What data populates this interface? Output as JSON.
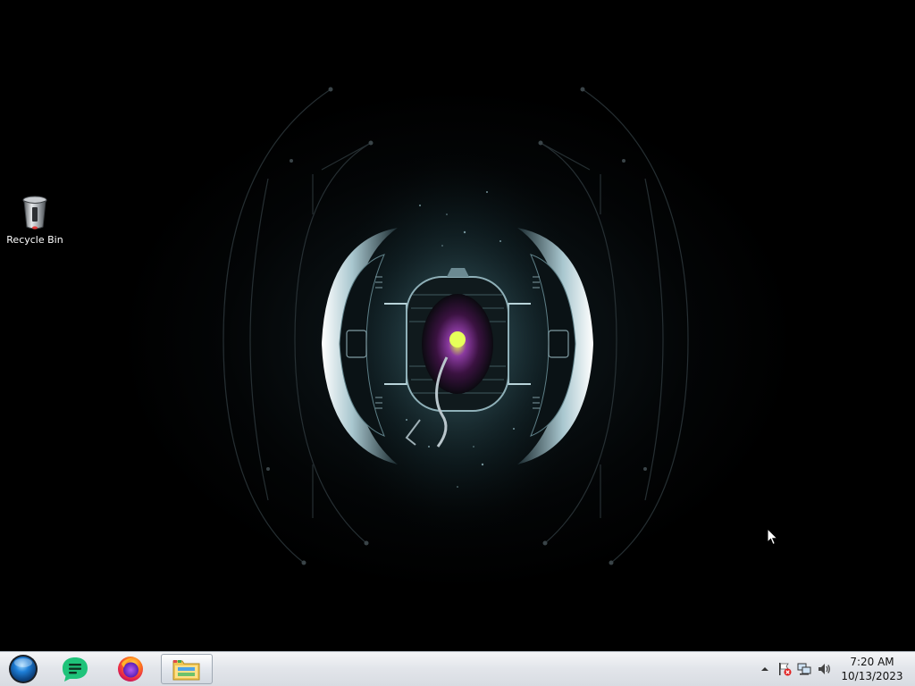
{
  "desktop": {
    "icons": [
      {
        "label": "Recycle Bin",
        "icon": "recycle-bin-icon"
      }
    ]
  },
  "taskbar": {
    "start": {
      "icon": "windows-orb-icon"
    },
    "pinned": [
      {
        "icon": "green-notes-app-icon"
      },
      {
        "icon": "firefox-icon"
      },
      {
        "icon": "file-explorer-icon",
        "active": true
      }
    ],
    "tray": {
      "icons": [
        "show-hidden-icons-chevron",
        "action-center-flag-icon",
        "network-icon",
        "volume-icon"
      ],
      "time": "7:20 AM",
      "date": "10/13/2023"
    }
  },
  "colors": {
    "taskbar": "#e2e5ea",
    "notes_green": "#1fc37a",
    "firefox_orange": "#ff7a1a",
    "orb_blue": "#1e7fd8"
  }
}
